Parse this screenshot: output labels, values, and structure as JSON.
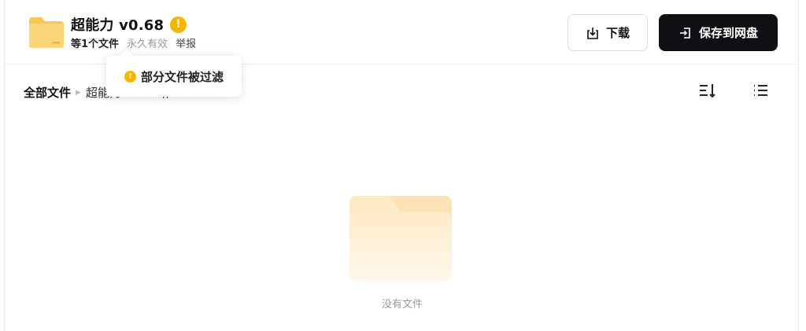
{
  "header": {
    "title": "超能力 v0.68",
    "warning_icon": "exclamation-icon",
    "file_count": "等1个文件",
    "validity": "永久有效",
    "report": "举报",
    "download_label": "下载",
    "save_label": "保存到网盘",
    "colors": {
      "warning": "#f7b500",
      "save_bg": "#0f1014",
      "folder": "#fbd57a"
    }
  },
  "tooltip": {
    "text": "部分文件被过滤"
  },
  "toolbar": {
    "breadcrumb_root": "全部文件",
    "breadcrumb_current": "超能力 v0.68 ,,32",
    "sort_icon": "sort-icon",
    "list_icon": "list-view-icon"
  },
  "empty": {
    "text": "没有文件"
  }
}
